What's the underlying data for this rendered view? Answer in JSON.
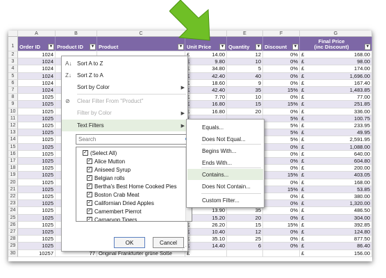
{
  "columns": [
    "A",
    "B",
    "C",
    "D",
    "E",
    "F",
    "G"
  ],
  "header": {
    "order_id": "Order ID",
    "product_id": "Product ID",
    "product": "Product",
    "unit_price": "Unit Price",
    "quantity": "Quantity",
    "discount": "Discount",
    "final_price_line1": "Final Price",
    "final_price_line2": "(inc Discount)"
  },
  "row_numbers": [
    "1",
    "2",
    "3",
    "4",
    "5",
    "6",
    "7",
    "8",
    "9",
    "10",
    "11",
    "12",
    "13",
    "14",
    "15",
    "16",
    "17",
    "18",
    "19",
    "20",
    "21",
    "22",
    "23",
    "24",
    "25",
    "26",
    "27",
    "28",
    "29",
    "30"
  ],
  "currency_symbol": "£",
  "rows": [
    {
      "order": "1024",
      "price": "14.00",
      "qty": "12",
      "disc": "0%",
      "final": "168.00"
    },
    {
      "order": "1024",
      "price": "9.80",
      "qty": "10",
      "disc": "0%",
      "final": "98.00"
    },
    {
      "order": "1024",
      "price": "34.80",
      "qty": "5",
      "disc": "0%",
      "final": "174.00"
    },
    {
      "order": "1024",
      "price": "42.40",
      "qty": "40",
      "disc": "0%",
      "final": "1,696.00"
    },
    {
      "order": "1024",
      "price": "18.60",
      "qty": "9",
      "disc": "0%",
      "final": "167.40"
    },
    {
      "order": "1024",
      "price": "42.40",
      "qty": "35",
      "disc": "15%",
      "final": "1,483.85"
    },
    {
      "order": "1025",
      "price": "7.70",
      "qty": "10",
      "disc": "0%",
      "final": "77.00"
    },
    {
      "order": "1025",
      "price": "16.80",
      "qty": "15",
      "disc": "15%",
      "final": "251.85"
    },
    {
      "order": "1025",
      "price": "16.80",
      "qty": "20",
      "disc": "0%",
      "final": "336.00"
    },
    {
      "order": "1025",
      "price": "",
      "qty": "",
      "disc": "5%",
      "final": "100.75"
    },
    {
      "order": "1025",
      "price": "",
      "qty": "",
      "disc": "5%",
      "final": "233.95"
    },
    {
      "order": "1025",
      "price": "",
      "qty": "",
      "disc": "5%",
      "final": "49.95"
    },
    {
      "order": "1025",
      "price": "",
      "qty": "",
      "disc": "5%",
      "final": "2,591.95"
    },
    {
      "order": "1025",
      "price": "",
      "qty": "",
      "disc": "0%",
      "final": "1,088.00"
    },
    {
      "order": "1025",
      "price": "",
      "qty": "",
      "disc": "0%",
      "final": "640.00"
    },
    {
      "order": "1025",
      "price": "",
      "qty": "",
      "disc": "0%",
      "final": "604.80"
    },
    {
      "order": "1025",
      "price": "",
      "qty": "",
      "disc": "0%",
      "final": "200.00"
    },
    {
      "order": "1025",
      "price": "",
      "qty": "",
      "disc": "15%",
      "final": "403.05"
    },
    {
      "order": "1025",
      "price": "",
      "qty": "",
      "disc": "0%",
      "final": "168.00"
    },
    {
      "order": "1025",
      "price": "",
      "qty": "",
      "disc": "15%",
      "final": "53.85"
    },
    {
      "order": "1025",
      "price": "",
      "qty": "",
      "disc": "0%",
      "final": "380.00"
    },
    {
      "order": "1025",
      "price": "44.00",
      "qty": "30",
      "disc": "0%",
      "final": "1,320.00"
    },
    {
      "order": "1025",
      "price": "13.90",
      "qty": "35",
      "disc": "0%",
      "final": "486.50"
    },
    {
      "order": "1025",
      "price": "15.20",
      "qty": "20",
      "disc": "0%",
      "final": "304.00"
    },
    {
      "order": "1025",
      "price": "26.20",
      "qty": "15",
      "disc": "15%",
      "final": "392.85"
    },
    {
      "order": "1025",
      "price": "10.40",
      "qty": "12",
      "disc": "0%",
      "final": "124.80"
    },
    {
      "order": "1025",
      "price": "35.10",
      "qty": "25",
      "disc": "0%",
      "final": "877.50"
    },
    {
      "order": "1025",
      "price": "14.40",
      "qty": "6",
      "disc": "0%",
      "final": "86.40"
    },
    {
      "order": "10257",
      "product_id": "77",
      "product": "Original Frankfurter grüne Soße",
      "price": "",
      "qty": "",
      "disc": "",
      "final": "156.00"
    }
  ],
  "filter_menu": {
    "sort_az": "Sort A to Z",
    "sort_za": "Sort Z to A",
    "sort_color": "Sort by Color",
    "clear_filter": "Clear Filter From \"Product\"",
    "filter_color": "Filter by Color",
    "text_filters": "Text Filters",
    "search_placeholder": "Search",
    "items": [
      "(Select All)",
      "Alice Mutton",
      "Aniseed Syrup",
      "Belgian rolls",
      "Bertha's Best Home Cooked Pies",
      "Boston Crab Meat",
      "Californian Dried Apples",
      "Camembert Pierrot",
      "Carnarvon Tigers"
    ],
    "ok": "OK",
    "cancel": "Cancel"
  },
  "text_filters_submenu": {
    "items": [
      "Equals...",
      "Does Not Equal...",
      "Begins With...",
      "Ends With...",
      "Contains...",
      "Does Not Contain...",
      "Custom Filter..."
    ],
    "highlighted": "Contains..."
  },
  "colors": {
    "header_purple": "#7d67a6",
    "band_lavender": "#e7e4f1",
    "arrow_green": "#6fbf26",
    "menu_highlight": "#e5efe0"
  }
}
